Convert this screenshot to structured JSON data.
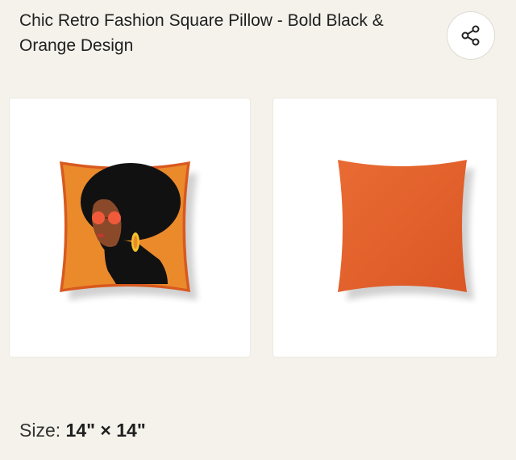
{
  "product": {
    "title": "Chic Retro Fashion Square Pillow - Bold Black & Orange Design"
  },
  "share": {
    "icon": "share-icon"
  },
  "gallery": {
    "images": [
      {
        "name": "pillow-front-image",
        "colors": {
          "pillow": "#ea8a2b",
          "edge": "#d9591f",
          "hair": "#111111",
          "skin": "#8a4a2a",
          "glasses": "#f05a3a",
          "earring": "#f3c22b"
        }
      },
      {
        "name": "pillow-back-image",
        "colors": {
          "pillow": "#e4602b",
          "shade": "#cf4f20"
        }
      }
    ]
  },
  "size": {
    "label": "Size:",
    "value": "14\" × 14\""
  }
}
